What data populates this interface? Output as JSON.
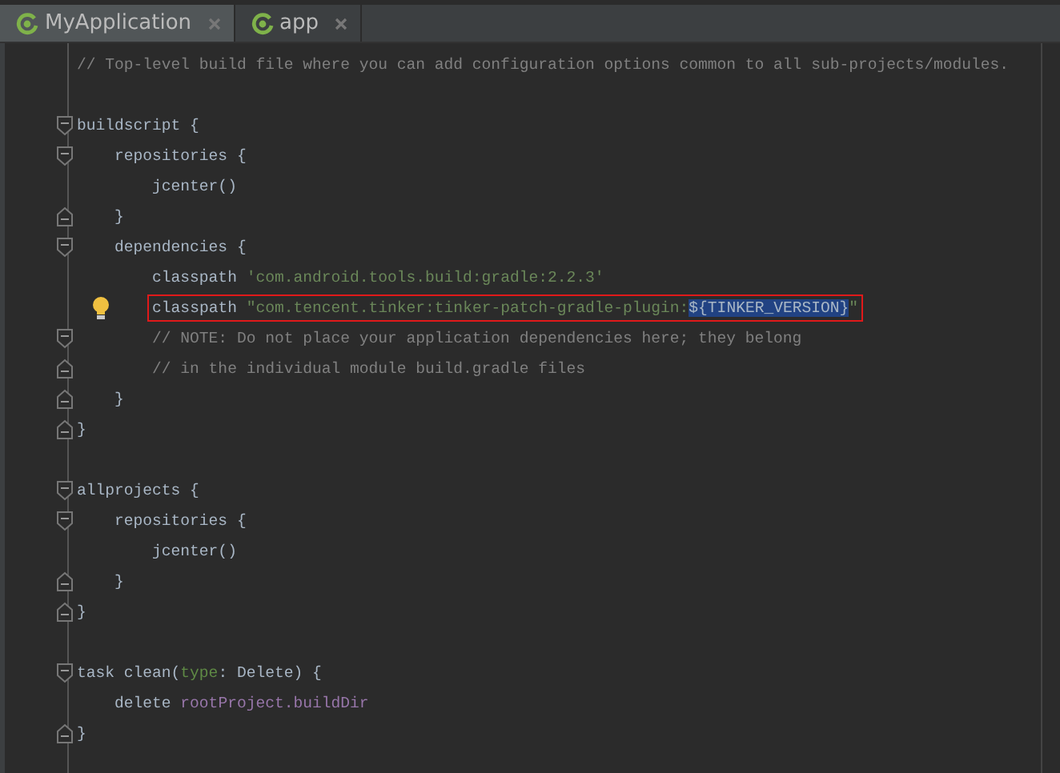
{
  "tabs": [
    {
      "label": "MyApplication",
      "selected": true
    },
    {
      "label": "app",
      "selected": false
    }
  ],
  "editor": {
    "lines": [
      {
        "kind": "plain",
        "tokens": [
          {
            "text": "// Top-level build file where you can add configuration options common to all sub-projects/modules.",
            "kind": "comment"
          }
        ]
      },
      {
        "kind": "blank"
      },
      {
        "kind": "foldstart",
        "tokens": [
          {
            "text": "buildscript {",
            "kind": "plain"
          }
        ]
      },
      {
        "kind": "foldstart",
        "tokens": [
          {
            "text": "    repositories {",
            "kind": "plain"
          }
        ]
      },
      {
        "kind": "plain",
        "tokens": [
          {
            "text": "        jcenter()",
            "kind": "plain"
          }
        ]
      },
      {
        "kind": "foldend",
        "tokens": [
          {
            "text": "    }",
            "kind": "plain"
          }
        ]
      },
      {
        "kind": "foldstart",
        "tokens": [
          {
            "text": "    dependencies {",
            "kind": "plain"
          }
        ]
      },
      {
        "kind": "plain",
        "tokens": [
          {
            "text": "        classpath ",
            "kind": "plain"
          },
          {
            "text": "'com.android.tools.build:gradle:2.2.3'",
            "kind": "string"
          }
        ]
      },
      {
        "kind": "plain",
        "bulb": true,
        "boxed": true,
        "tokens": [
          {
            "text": "        classpath ",
            "kind": "plain"
          },
          {
            "text": "\"com.tencent.tinker:tinker-patch-gradle-plugin:",
            "kind": "string"
          },
          {
            "text": "${TINKER_VERSION}",
            "kind": "plain",
            "selected": true
          },
          {
            "text": "\"",
            "kind": "string"
          }
        ]
      },
      {
        "kind": "foldstart",
        "tokens": [
          {
            "text": "        // NOTE: Do not place your application dependencies here; they belong",
            "kind": "comment"
          }
        ]
      },
      {
        "kind": "foldend",
        "tokens": [
          {
            "text": "        // in the individual module build.gradle files",
            "kind": "comment"
          }
        ]
      },
      {
        "kind": "foldend",
        "tokens": [
          {
            "text": "    }",
            "kind": "plain"
          }
        ]
      },
      {
        "kind": "foldend",
        "tokens": [
          {
            "text": "}",
            "kind": "plain"
          }
        ]
      },
      {
        "kind": "blank"
      },
      {
        "kind": "foldstart",
        "tokens": [
          {
            "text": "allprojects {",
            "kind": "plain"
          }
        ]
      },
      {
        "kind": "foldstart",
        "tokens": [
          {
            "text": "    repositories {",
            "kind": "plain"
          }
        ]
      },
      {
        "kind": "plain",
        "tokens": [
          {
            "text": "        jcenter()",
            "kind": "plain"
          }
        ]
      },
      {
        "kind": "foldend",
        "tokens": [
          {
            "text": "    }",
            "kind": "plain"
          }
        ]
      },
      {
        "kind": "foldend",
        "tokens": [
          {
            "text": "}",
            "kind": "plain"
          }
        ]
      },
      {
        "kind": "blank"
      },
      {
        "kind": "foldstart",
        "tokens": [
          {
            "text": "task clean(",
            "kind": "plain"
          },
          {
            "text": "type",
            "kind": "param"
          },
          {
            "text": ": Delete) {",
            "kind": "plain"
          }
        ]
      },
      {
        "kind": "plain",
        "tokens": [
          {
            "text": "    delete ",
            "kind": "plain"
          },
          {
            "text": "rootProject.buildDir",
            "kind": "field"
          }
        ]
      },
      {
        "kind": "foldend",
        "tokens": [
          {
            "text": "}",
            "kind": "plain"
          }
        ]
      }
    ]
  }
}
